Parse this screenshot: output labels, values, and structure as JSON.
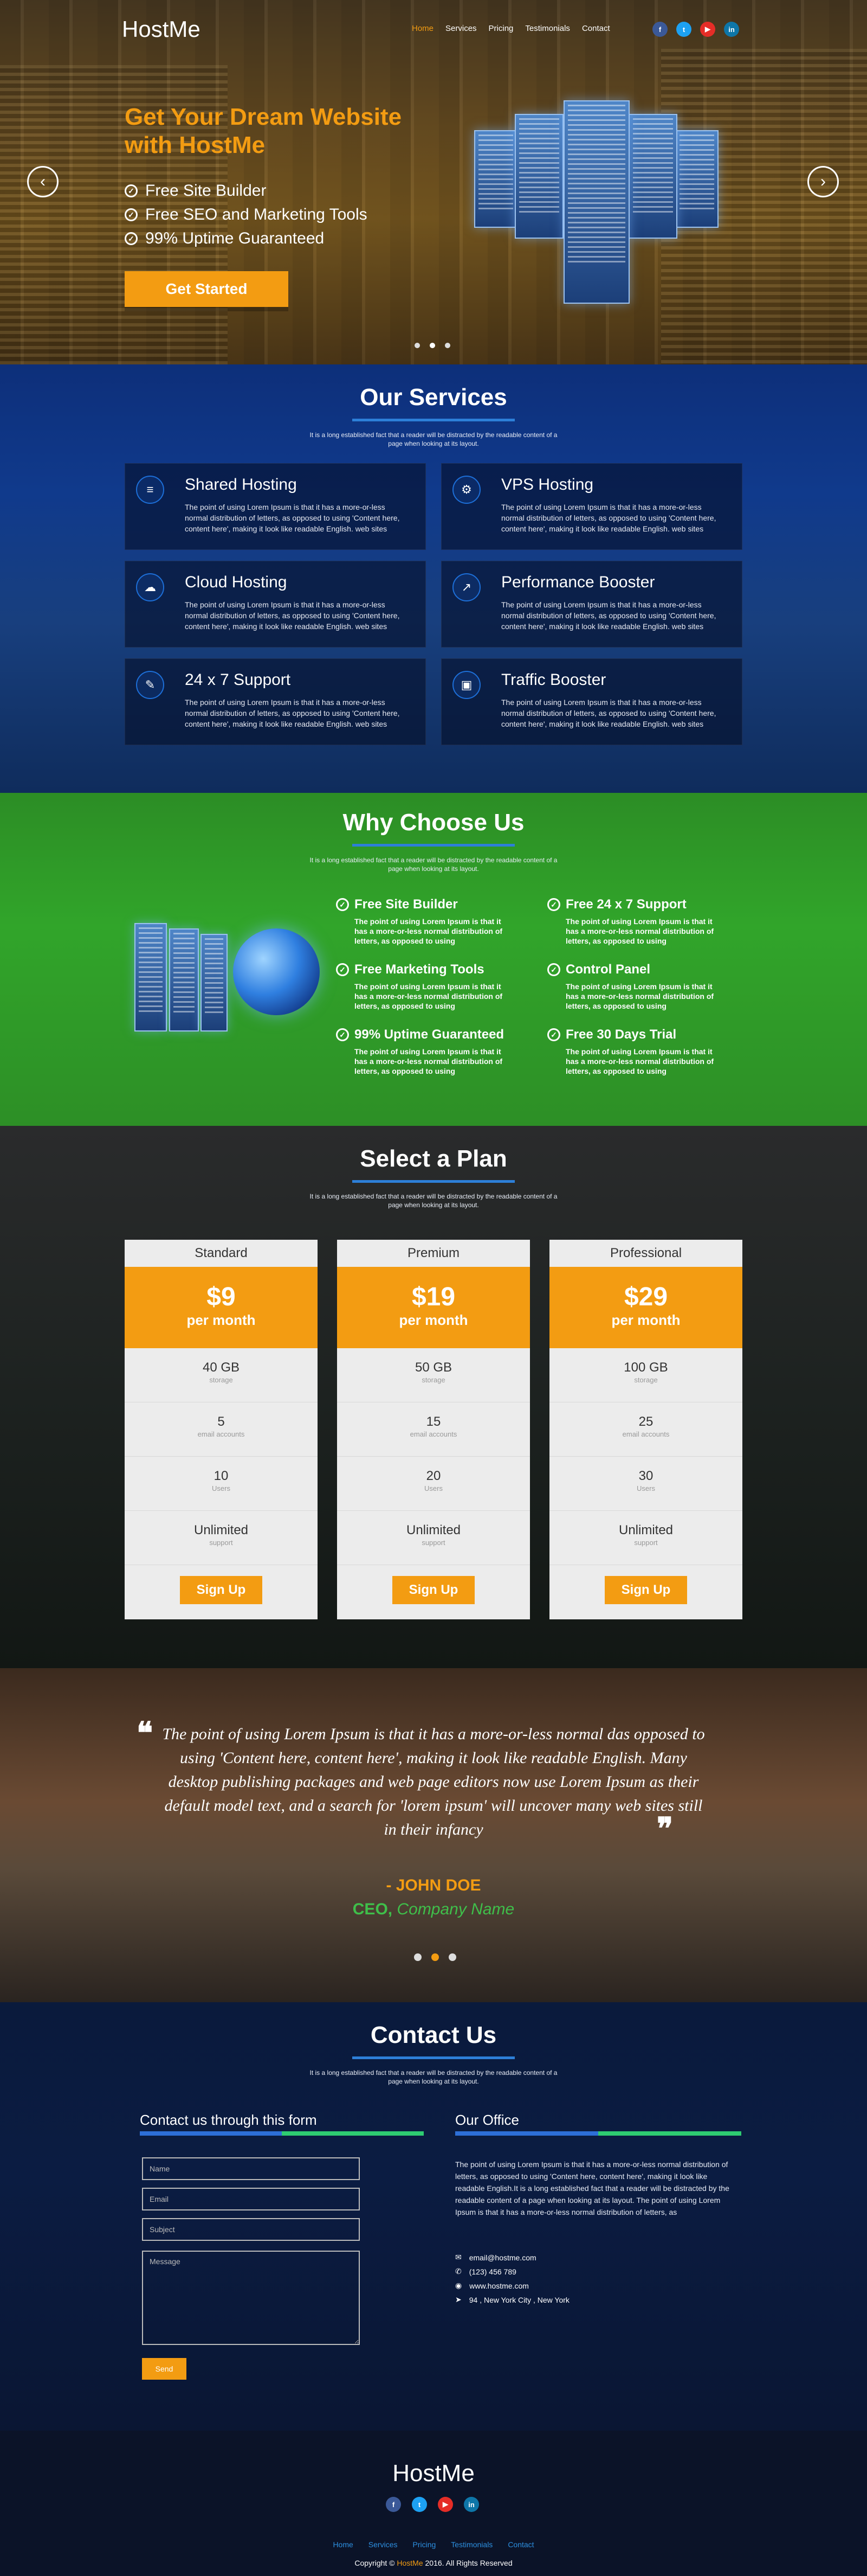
{
  "brand": {
    "name": "HostMe",
    "accent": "#f39c12",
    "blue": "#2d7fd8",
    "green": "#2ecc71"
  },
  "nav": [
    {
      "label": "Home",
      "active": true
    },
    {
      "label": "Services"
    },
    {
      "label": "Pricing"
    },
    {
      "label": "Testimonials"
    },
    {
      "label": "Contact"
    }
  ],
  "social": [
    {
      "icon": "facebook-icon",
      "glyph": "f"
    },
    {
      "icon": "twitter-icon",
      "glyph": "t"
    },
    {
      "icon": "youtube-icon",
      "glyph": "▶"
    },
    {
      "icon": "linkedin-icon",
      "glyph": "in"
    }
  ],
  "hero": {
    "title": "Get Your Dream Website with HostMe",
    "features": [
      "Free Site Builder",
      "Free SEO and Marketing Tools",
      "99% Uptime Guaranteed"
    ],
    "cta": "Get Started",
    "prev": "‹",
    "next": "›"
  },
  "services": {
    "title": "Our Services",
    "subtitle": "It is a long established fact that a reader will be distracted by the readable content of a page when looking at its layout.",
    "items": [
      {
        "title": "Shared Hosting",
        "icon": "menu-icon",
        "glyph": "≡",
        "text": "The point of using Lorem Ipsum is that it has a more-or-less normal distribution of letters, as opposed to using 'Content here, content here', making it look like readable English. web sites"
      },
      {
        "title": "VPS Hosting",
        "icon": "gears-icon",
        "glyph": "⚙",
        "text": "The point of using Lorem Ipsum is that it has a more-or-less normal distribution of letters, as opposed to using 'Content here, content here', making it look like readable English. web sites"
      },
      {
        "title": "Cloud Hosting",
        "icon": "cloud-icon",
        "glyph": "☁",
        "text": "The point of using Lorem Ipsum is that it has a more-or-less normal distribution of letters, as opposed to using 'Content here, content here', making it look like readable English. web sites"
      },
      {
        "title": "Performance Booster",
        "icon": "chart-icon",
        "glyph": "↗",
        "text": "The point of using Lorem Ipsum is that it has a more-or-less normal distribution of letters, as opposed to using 'Content here, content here', making it look like readable English. web sites"
      },
      {
        "title": "24 x 7 Support",
        "icon": "tools-icon",
        "glyph": "✎",
        "text": "The point of using Lorem Ipsum is that it has a more-or-less normal distribution of letters, as opposed to using 'Content here, content here', making it look like readable English. web sites"
      },
      {
        "title": "Traffic Booster",
        "icon": "briefcase-icon",
        "glyph": "▣",
        "text": "The point of using Lorem Ipsum is that it has a more-or-less normal distribution of letters, as opposed to using 'Content here, content here', making it look like readable English. web sites"
      }
    ]
  },
  "why": {
    "title": "Why Choose Us",
    "subtitle": "It is a long established fact that a reader will be distracted by the readable content of a page when looking at its layout.",
    "items": [
      {
        "title": "Free Site Builder",
        "text": "The point of using Lorem Ipsum is that it has a more-or-less normal distribution of letters, as opposed to using"
      },
      {
        "title": "Free 24 x 7 Support",
        "text": "The point of using Lorem Ipsum is that it has a more-or-less normal distribution of letters, as opposed to using"
      },
      {
        "title": "Free Marketing Tools",
        "text": "The point of using Lorem Ipsum is that it has a more-or-less normal distribution of letters, as opposed to using"
      },
      {
        "title": "Control Panel",
        "text": "The point of using Lorem Ipsum is that it has a more-or-less normal distribution of letters, as opposed to using"
      },
      {
        "title": "99% Uptime Guaranteed",
        "text": "The point of using Lorem Ipsum is that it has a more-or-less normal distribution of letters, as opposed to using"
      },
      {
        "title": "Free 30 Days Trial",
        "text": "The point of using Lorem Ipsum is that it has a more-or-less normal distribution of letters, as opposed to using"
      }
    ]
  },
  "plans": {
    "title": "Select a Plan",
    "subtitle": "It is a long established fact that a reader will be distracted by the readable content of a page when looking at its layout.",
    "items": [
      {
        "name": "Standard",
        "price": "$9",
        "period": "per month",
        "features": [
          {
            "v": "40 GB",
            "l": "storage"
          },
          {
            "v": "5",
            "l": "email accounts"
          },
          {
            "v": "10",
            "l": "Users"
          },
          {
            "v": "Unlimited",
            "l": "support"
          }
        ],
        "cta": "Sign Up"
      },
      {
        "name": "Premium",
        "price": "$19",
        "period": "per month",
        "features": [
          {
            "v": "50 GB",
            "l": "storage"
          },
          {
            "v": "15",
            "l": "email accounts"
          },
          {
            "v": "20",
            "l": "Users"
          },
          {
            "v": "Unlimited",
            "l": "support"
          }
        ],
        "cta": "Sign Up"
      },
      {
        "name": "Professional",
        "price": "$29",
        "period": "per month",
        "features": [
          {
            "v": "100 GB",
            "l": "storage"
          },
          {
            "v": "25",
            "l": "email accounts"
          },
          {
            "v": "30",
            "l": "Users"
          },
          {
            "v": "Unlimited",
            "l": "support"
          }
        ],
        "cta": "Sign Up"
      }
    ]
  },
  "testimonial": {
    "quote": "The point of using Lorem Ipsum is that it has a more-or-less normal das opposed to using 'Content here, content here', making it look like readable English. Many desktop publishing packages and web page editors now use Lorem Ipsum as their default model text, and a search for 'lorem ipsum' will uncover many web sites still in their infancy",
    "author": "- JOHN DOE",
    "role": "CEO,",
    "company": "Company Name"
  },
  "contact": {
    "title": "Contact Us",
    "subtitle": "It is a long established fact that a reader will be distracted by the readable content of a page when looking at its layout.",
    "form_title": "Contact us through this form",
    "name_ph": "Name",
    "email_ph": "Email",
    "subject_ph": "Subject",
    "message_ph": "Message",
    "send": "Send",
    "office_title": "Our Office",
    "office_text": "The point of using Lorem Ipsum is that it has a more-or-less normal distribution of letters, as opposed to using 'Content here, content here', making it look like readable English.It is a long established fact that a reader will be distracted by the readable content of a page when looking at its layout. The point of using Lorem Ipsum is that it has a more-or-less normal distribution of letters, as",
    "email": "email@hostme.com",
    "phone": "(123) 456 789",
    "web": "www.hostme.com",
    "address": "94 , New York City , New York"
  },
  "footer": {
    "logo": "HostMe",
    "nav": [
      "Home",
      "Services",
      "Pricing",
      "Testimonials",
      "Contact"
    ],
    "copy_pre": "Copyright ©",
    "copy_brand": "HostMe",
    "copy_post": "2016. All Rights Reserved"
  }
}
